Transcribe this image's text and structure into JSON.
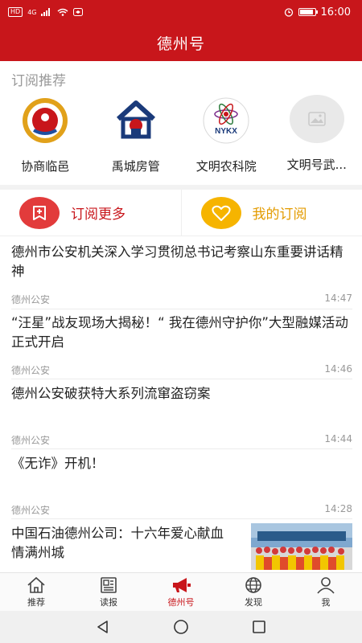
{
  "status_bar": {
    "network_chip": "HD",
    "signal_text": "4G",
    "time": "16:00",
    "battery_level": 0.9
  },
  "header": {
    "title": "德州号"
  },
  "recommendations": {
    "title": "订阅推荐",
    "items": [
      {
        "label": "协商临邑",
        "icon": "xieshang-logo"
      },
      {
        "label": "禹城房管",
        "icon": "house-logo"
      },
      {
        "label": "文明农科院",
        "icon": "nykx-logo",
        "logo_text": "NYKX"
      },
      {
        "label": "文明号武...",
        "icon": "image-placeholder-icon"
      }
    ]
  },
  "actions": {
    "more": {
      "label": "订阅更多",
      "icon": "add-subscribe-icon"
    },
    "mine": {
      "label": "我的订阅",
      "icon": "heart-icon"
    }
  },
  "news": [
    {
      "title": "德州市公安机关深入学习贯彻总书记考察山东重要讲话精神",
      "source": "德州公安",
      "time": "14:47"
    },
    {
      "title": "“汪星”战友现场大揭秘！“ 我在德州守护你”大型融媒活动正式开启",
      "source": "德州公安",
      "time": "14:46"
    },
    {
      "title": "德州公安破获特大系列流窜盗窃案",
      "source": "德州公安",
      "time": "14:44"
    },
    {
      "title": "《无诈》开机！",
      "source": "德州公安",
      "time": "14:28"
    },
    {
      "title": "中国石油德州公司：十六年爱心献血情满州城",
      "has_thumbnail": true
    }
  ],
  "bottom_nav": [
    {
      "label": "推荐",
      "icon": "home-icon",
      "active": false
    },
    {
      "label": "读报",
      "icon": "newspaper-icon",
      "active": false
    },
    {
      "label": "德州号",
      "icon": "megaphone-icon",
      "active": true
    },
    {
      "label": "发现",
      "icon": "globe-icon",
      "active": false
    },
    {
      "label": "我",
      "icon": "user-icon",
      "active": false
    }
  ],
  "colors": {
    "brand_red": "#c8161b",
    "accent_orange": "#f6b400",
    "meta_gray": "#999999"
  }
}
